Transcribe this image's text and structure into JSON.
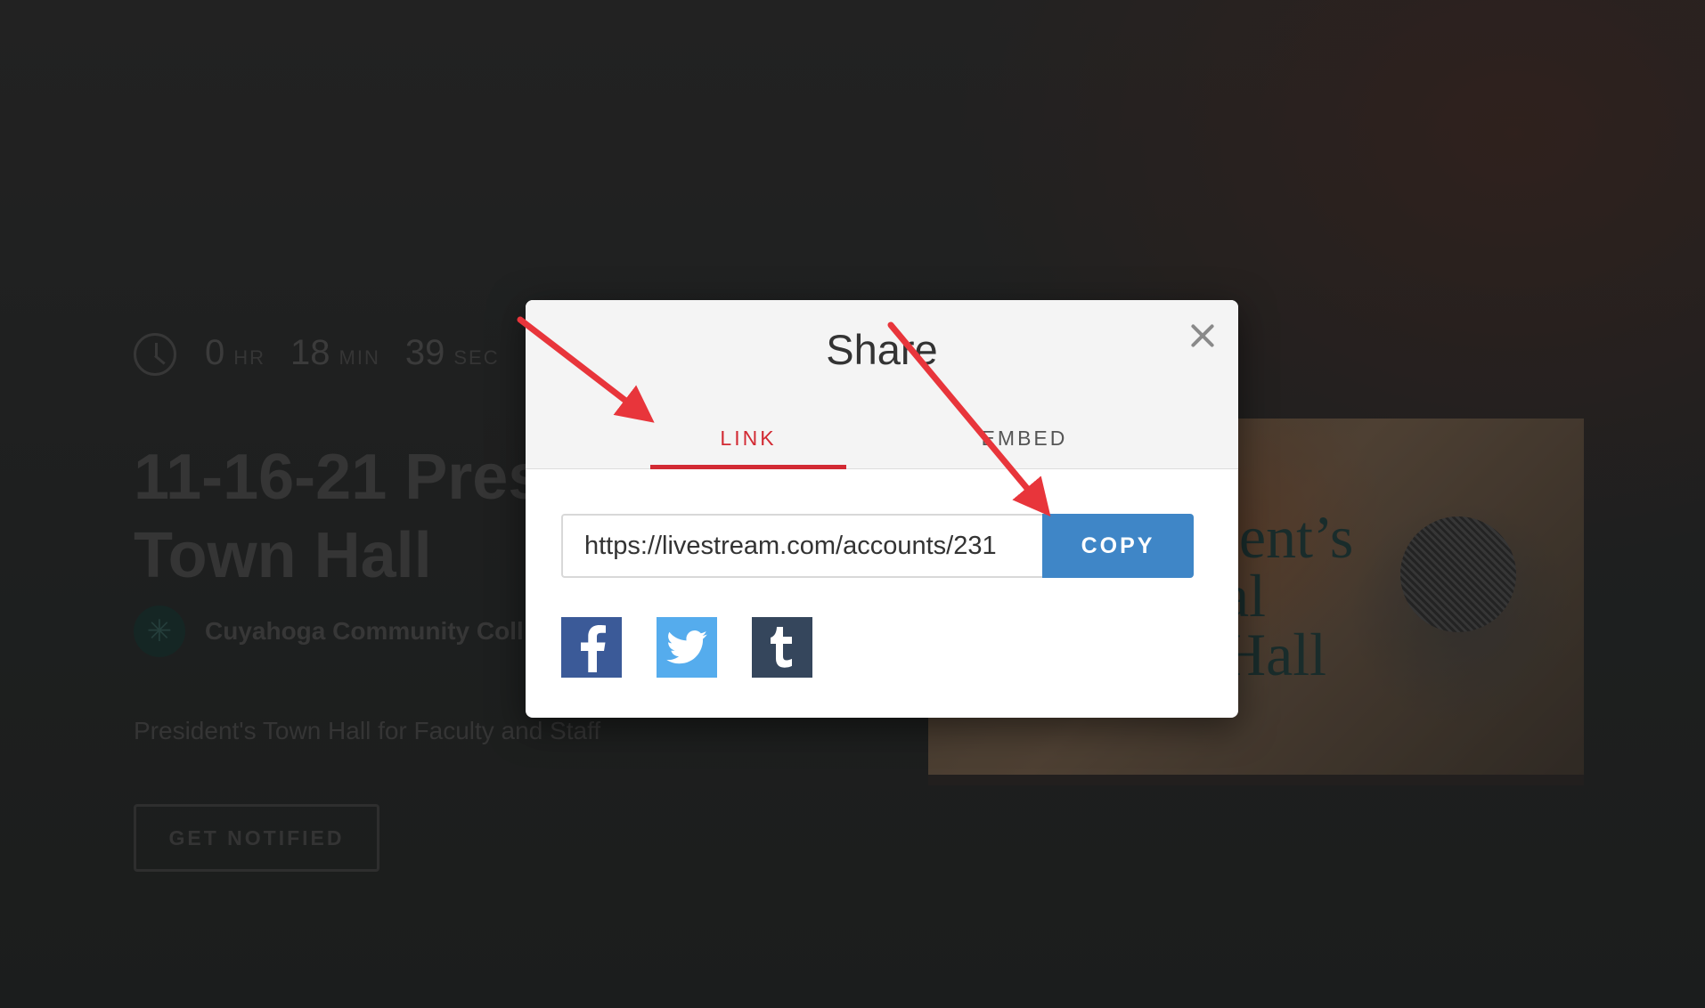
{
  "background": {
    "countdown": [
      {
        "value": "0",
        "unit": "HR"
      },
      {
        "value": "18",
        "unit": "MIN"
      },
      {
        "value": "39",
        "unit": "SEC"
      }
    ],
    "event_title_line1": "11-16-21 Pres",
    "event_title_line2": "Town Hall",
    "organization": "Cuyahoga Community Coll",
    "description": "President's Town Hall for Faculty and Staff",
    "notify_button": "GET NOTIFIED",
    "thumbnail_text_line1": "lent’s",
    "thumbnail_text_line2": "al",
    "thumbnail_text_line3": "Hall"
  },
  "modal": {
    "title": "Share",
    "tabs": [
      {
        "label": "LINK",
        "active": true
      },
      {
        "label": "EMBED",
        "active": false
      }
    ],
    "url_value": "https://livestream.com/accounts/231",
    "copy_label": "COPY",
    "social": [
      {
        "icon": "facebook-icon",
        "color": "#3b5a98"
      },
      {
        "icon": "twitter-icon",
        "color": "#55aced"
      },
      {
        "icon": "tumblr-icon",
        "color": "#35465c"
      }
    ]
  },
  "colors": {
    "accent_red": "#d22a33",
    "copy_blue": "#3f86c7",
    "annotation_red": "#e8353b"
  }
}
